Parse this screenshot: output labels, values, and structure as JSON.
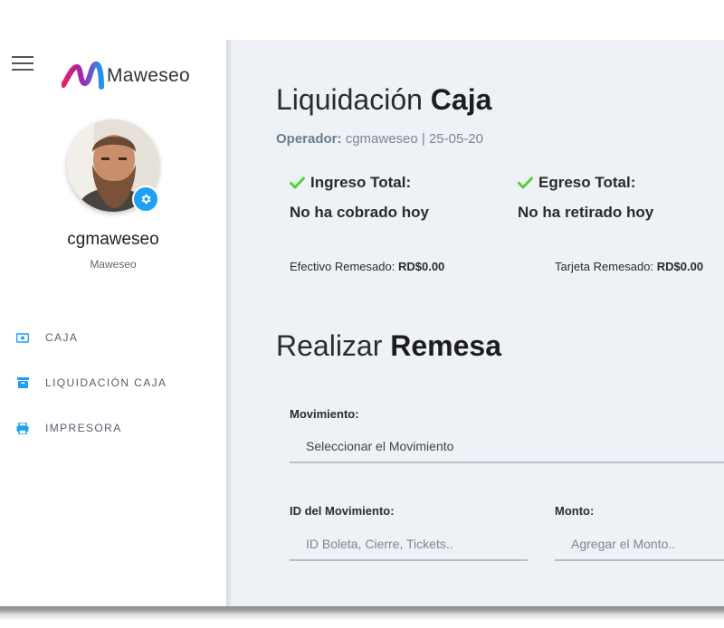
{
  "brand": {
    "name": "Maweseo"
  },
  "user": {
    "name": "cgmaweseo",
    "company": "Maweseo"
  },
  "nav": {
    "items": [
      {
        "label": "CAJA",
        "icon": "cash-icon"
      },
      {
        "label": "LIQUIDACIÓN CAJA",
        "icon": "archive-icon"
      },
      {
        "label": "IMPRESORA",
        "icon": "printer-icon"
      }
    ]
  },
  "header": {
    "title_light": "Liquidación",
    "title_bold": "Caja",
    "operator_label": "Operador:",
    "operator_value": "cgmaweseo | 25-05-20"
  },
  "stats": {
    "ingreso": {
      "title": "Ingreso Total:",
      "value": "No ha cobrado hoy"
    },
    "egreso": {
      "title": "Egreso Total:",
      "value": "No ha retirado hoy"
    },
    "efectivo": {
      "label": "Efectivo Remesado:",
      "value": "RD$0.00"
    },
    "tarjeta": {
      "label": "Tarjeta Remesado:",
      "value": "RD$0.00"
    }
  },
  "remesa": {
    "title_light": "Realizar",
    "title_bold": "Remesa",
    "movimiento": {
      "label": "Movimiento:",
      "value": "Seleccionar el Movimiento"
    },
    "id": {
      "label": "ID del Movimiento:",
      "placeholder": "ID Boleta, Cierre, Tickets.."
    },
    "monto": {
      "label": "Monto:",
      "placeholder": "Agregar el Monto.."
    }
  },
  "colors": {
    "accent": "#1da1f2",
    "check": "#4cd137",
    "background_main": "#eef1f5",
    "brand_pink": "#e91e63",
    "brand_blue": "#2196f3"
  }
}
